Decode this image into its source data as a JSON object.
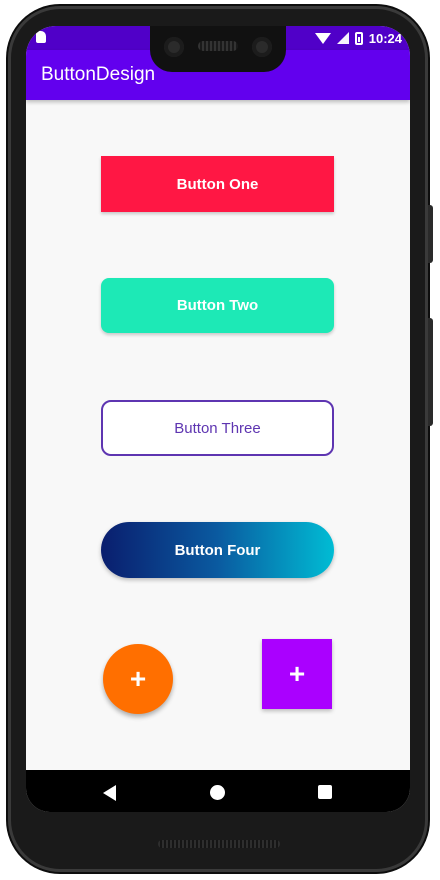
{
  "status_bar": {
    "time": "10:24",
    "icons": [
      "sim-card-icon",
      "wifi-icon",
      "signal-icon",
      "battery-icon"
    ],
    "background": "#5000c8"
  },
  "app_bar": {
    "title": "ButtonDesign",
    "background": "#6200ee"
  },
  "buttons": {
    "one": {
      "label": "Button One",
      "color": "#ff1744"
    },
    "two": {
      "label": "Button Two",
      "color": "#1de9b6"
    },
    "three": {
      "label": "Button Three",
      "border_color": "#5e35b1"
    },
    "four": {
      "label": "Button Four",
      "gradient": [
        "#0a1e6e",
        "#00bcd4"
      ]
    }
  },
  "fabs": {
    "round": {
      "symbol": "+",
      "color": "#ff6f00"
    },
    "square": {
      "symbol": "+",
      "color": "#aa00ff"
    }
  },
  "nav_bar": {
    "icons": [
      "back-icon",
      "home-icon",
      "recents-icon"
    ]
  }
}
